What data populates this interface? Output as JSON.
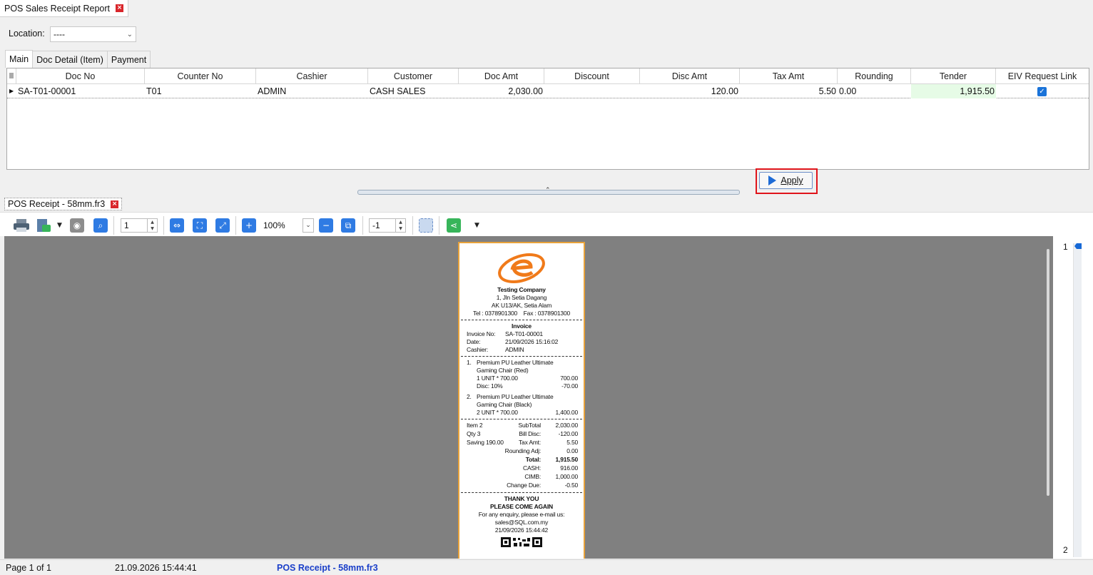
{
  "window": {
    "tab_title": "POS Sales Receipt Report",
    "close_glyph": "×"
  },
  "filter": {
    "location_label": "Location:",
    "location_value": "----"
  },
  "tabs": [
    "Main",
    "Doc Detail (Item)",
    "Payment"
  ],
  "grid": {
    "columns": [
      "Doc No",
      "Counter No",
      "Cashier",
      "Customer",
      "Doc Amt",
      "Discount",
      "Disc Amt",
      "Tax Amt",
      "Rounding",
      "Tender",
      "EIV Request Link"
    ],
    "rows": [
      {
        "doc_no": "SA-T01-00001",
        "counter_no": "T01",
        "cashier": "ADMIN",
        "customer": "CASH SALES",
        "doc_amt": "2,030.00",
        "discount": "",
        "disc_amt": "120.00",
        "tax_amt": "5.50",
        "rounding": "0.00",
        "tender": "1,915.50",
        "eiv_request_link": true
      }
    ]
  },
  "apply_button": {
    "label": "Apply"
  },
  "report_tab": {
    "title": "POS Receipt - 58mm.fr3"
  },
  "toolbar": {
    "page_value": "1",
    "zoom": "100%",
    "offset_value": "-1"
  },
  "receipt": {
    "company": "Testing Company",
    "address1": "1, Jln Setia Dagang",
    "address2": "AK U13/AK, Setia Alam",
    "contact": "Tel : 0378901300    Fax : 0378901300",
    "doc_title": "Invoice",
    "invoice_no_label": "Invoice No:",
    "invoice_no": "SA-T01-00001",
    "date_label": "Date:",
    "date": "21/09/2026 15:16:02",
    "cashier_label": "Cashier:",
    "cashier": "ADMIN",
    "items": [
      {
        "no": "1.",
        "name1": "Premium PU Leather Ultimate",
        "name2": "Gaming Chair (Red)",
        "qty_line": "1 UNIT * 700.00",
        "amount": "700.00",
        "disc_label": "Disc: 10%",
        "disc_amount": "-70.00"
      },
      {
        "no": "2.",
        "name1": "Premium PU Leather Ultimate",
        "name2": "Gaming Chair (Black)",
        "qty_line": "2 UNIT * 700.00",
        "amount": "1,400.00"
      }
    ],
    "summary": {
      "item_count": "Item 2",
      "qty": "Qty 3",
      "saving": "Saving 190.00",
      "subtotal_label": "SubTotal",
      "subtotal": "2,030.00",
      "bill_disc_label": "Bill Disc:",
      "bill_disc": "-120.00",
      "tax_label": "Tax Amt:",
      "tax": "5.50",
      "rounding_label": "Rounding Adj:",
      "rounding": "0.00",
      "total_label": "Total:",
      "total": "1,915.50",
      "cash_label": "CASH:",
      "cash": "916.00",
      "cimb_label": "CIMB:",
      "cimb": "1,000.00",
      "change_label": "Change Due:",
      "change": "-0.50"
    },
    "footer1": "THANK YOU",
    "footer2": "PLEASE COME AGAIN",
    "footer3": "For any enquiry, please e-mail us:",
    "footer4": "sales@SQL.com.my",
    "footer5": "21/09/2026 15:44:42"
  },
  "page_thumbs": [
    "1",
    "2"
  ],
  "statusbar": {
    "page": "Page 1 of 1",
    "datetime": "21.09.2026 15:44:41",
    "report": "POS Receipt - 58mm.fr3"
  },
  "colors": {
    "accent": "#1e6bd6",
    "highlight": "#e0141a",
    "receipt_border": "#e8a23a",
    "logo": "#f07a1a"
  }
}
